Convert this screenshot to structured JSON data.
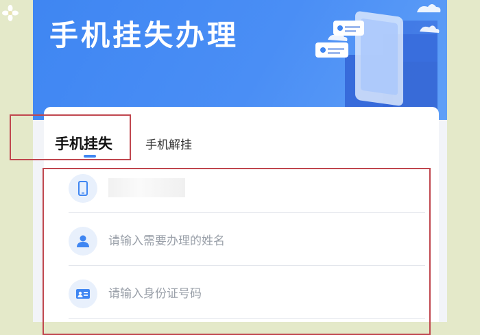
{
  "banner": {
    "title": "手机挂失办理"
  },
  "tabs": [
    {
      "label": "手机挂失",
      "active": true
    },
    {
      "label": "手机解挂",
      "active": false
    }
  ],
  "form": {
    "fields": [
      {
        "icon": "phone-icon",
        "value": "",
        "placeholder": ""
      },
      {
        "icon": "person-icon",
        "value": "",
        "placeholder": "请输入需要办理的姓名"
      },
      {
        "icon": "id-card-icon",
        "value": "",
        "placeholder": "请输入身份证号码"
      }
    ]
  },
  "colors": {
    "accent": "#3f86f2",
    "highlight": "#c0464e",
    "icon_bg": "#e8f0fc"
  }
}
